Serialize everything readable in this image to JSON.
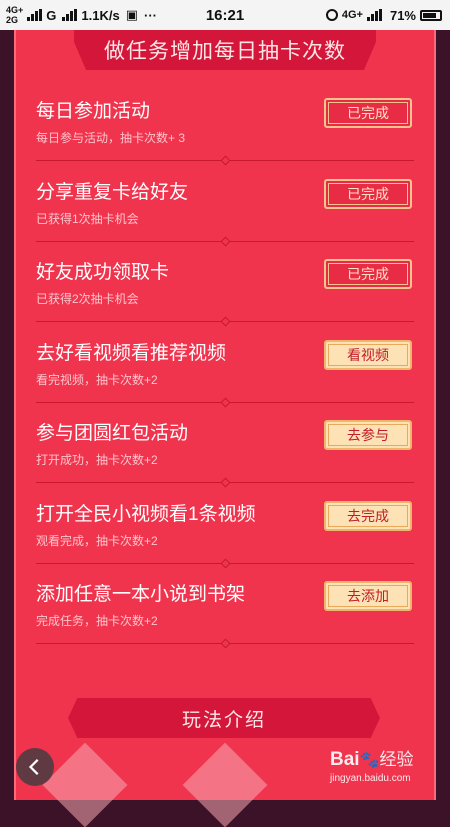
{
  "status_bar": {
    "net_top": "4G+",
    "net_bottom": "2G",
    "carrier": "G",
    "speed": "1.1K/s",
    "time": "16:21",
    "net_right": "4G+",
    "battery": "71%"
  },
  "header": {
    "title": "做任务增加每日抽卡次数"
  },
  "tasks": [
    {
      "title": "每日参加活动",
      "subtitle": "每日参与活动，抽卡次数+ 3",
      "button": "已完成",
      "state": "done"
    },
    {
      "title": "分享重复卡给好友",
      "subtitle": "已获得1次抽卡机会",
      "button": "已完成",
      "state": "done"
    },
    {
      "title": "好友成功领取卡",
      "subtitle": "已获得2次抽卡机会",
      "button": "已完成",
      "state": "done"
    },
    {
      "title": "去好看视频看推荐视频",
      "subtitle": "看完视频，抽卡次数+2",
      "button": "看视频",
      "state": "todo"
    },
    {
      "title": "参与团圆红包活动",
      "subtitle": "打开成功，抽卡次数+2",
      "button": "去参与",
      "state": "todo"
    },
    {
      "title": "打开全民小视频看1条视频",
      "subtitle": "观看完成，抽卡次数+2",
      "button": "去完成",
      "state": "todo"
    },
    {
      "title": "添加任意一本小说到书架",
      "subtitle": "完成任务，抽卡次数+2",
      "button": "去添加",
      "state": "todo"
    }
  ],
  "rules": {
    "title": "玩法介绍"
  },
  "watermark": {
    "brand": "Bai",
    "brand2": "经验",
    "url": "jingyan.baidu.com"
  },
  "colors": {
    "panel": "#f0344e",
    "banner": "#d3163a",
    "button_done": "#e92c45",
    "button_go": "#fce2b4"
  }
}
